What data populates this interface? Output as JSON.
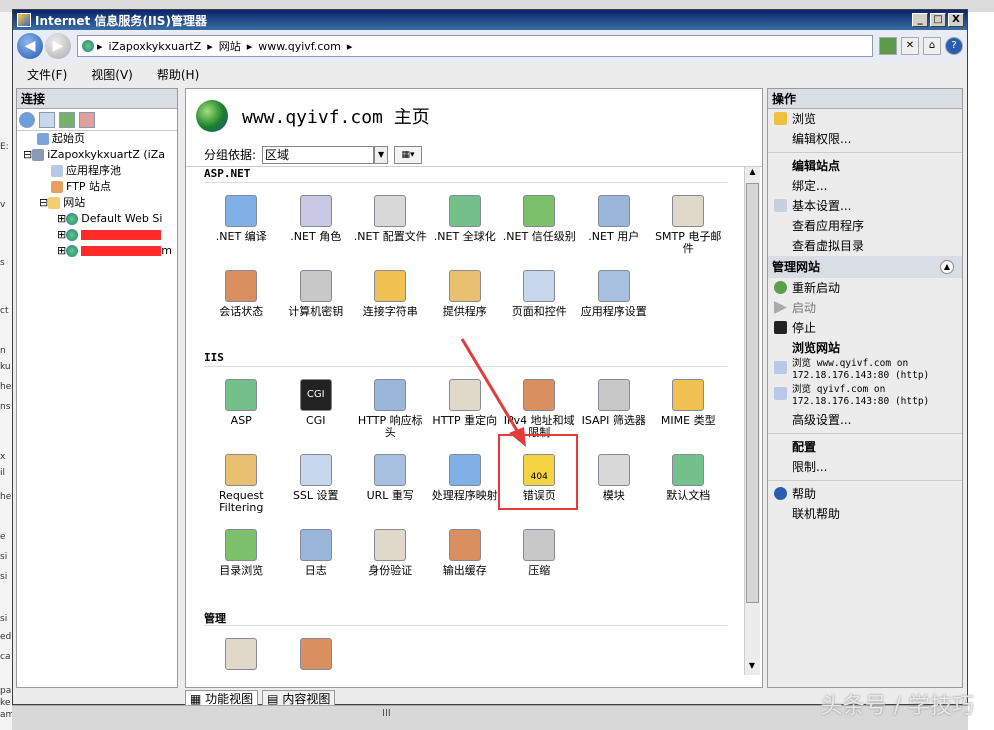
{
  "window": {
    "title": "Internet 信息服务(IIS)管理器",
    "controls": [
      "_",
      "□",
      "X"
    ]
  },
  "left_edge_chars": [
    "E:",
    "v",
    "s",
    "ct",
    "n",
    "ku",
    "he",
    "ns",
    "x",
    "il",
    "he",
    "e",
    "si",
    "si",
    "si",
    "ed",
    "ca",
    "pa",
    "ke",
    "am"
  ],
  "address": {
    "back": "◀",
    "forward": "▶",
    "crumbs": [
      "iZapoxkykxuartZ",
      "网站",
      "www.qyivf.com"
    ]
  },
  "menu": [
    "文件(F)",
    "视图(V)",
    "帮助(H)"
  ],
  "left_pane": {
    "header": "连接",
    "tree": [
      {
        "label": "起始页",
        "depth": 1
      },
      {
        "label": "iZapoxkykxuartZ (iZa",
        "depth": 0
      },
      {
        "label": "应用程序池",
        "depth": 2
      },
      {
        "label": "FTP 站点",
        "depth": 2
      },
      {
        "label": "网站",
        "depth": 2
      },
      {
        "label": "Default Web Si",
        "depth": 3
      },
      {
        "label": "",
        "depth": 3,
        "redacted": true
      },
      {
        "label": "m",
        "depth": 3,
        "redacted": true
      }
    ]
  },
  "center": {
    "title": "www.qyivf.com 主页",
    "group_by_label": "分组依据:",
    "group_by_value": "区域",
    "sections": [
      {
        "name": "ASP.NET",
        "items": [
          ".NET 编译",
          ".NET 角色",
          ".NET 配置文件",
          ".NET 全球化",
          ".NET 信任级别",
          ".NET 用户",
          "SMTP 电子邮件",
          "会话状态",
          "计算机密钥",
          "连接字符串",
          "提供程序",
          "页面和控件",
          "应用程序设置"
        ]
      },
      {
        "name": "IIS",
        "items": [
          "ASP",
          "CGI",
          "HTTP 响应标头",
          "HTTP 重定向",
          "IPv4 地址和域限制",
          "ISAPI 筛选器",
          "MIME 类型",
          "Request Filtering",
          "SSL 设置",
          "URL 重写",
          "处理程序映射",
          "错误页",
          "模块",
          "默认文档",
          "目录浏览",
          "日志",
          "身份验证",
          "输出缓存",
          "压缩"
        ]
      },
      {
        "name": "管理",
        "items": [
          "",
          ""
        ]
      }
    ],
    "highlighted_item": "错误页",
    "icon_text": {
      "cgi": "CGI",
      "error": "404"
    }
  },
  "bottom_tabs": [
    "功能视图",
    "内容视图"
  ],
  "right_pane": {
    "header": "操作",
    "actions_top": [
      "浏览",
      "编辑权限..."
    ],
    "edit_site_header": "编辑站点",
    "edit_site": [
      "绑定...",
      "基本设置...",
      "查看应用程序",
      "查看虚拟目录"
    ],
    "manage_header": "管理网站",
    "manage": [
      "重新启动",
      "启动",
      "停止"
    ],
    "browse_header": "浏览网站",
    "browse": [
      "浏览 www.qyivf.com on 172.18.176.143:80 (http)",
      "浏览 qyivf.com on 172.18.176.143:80 (http)"
    ],
    "advanced": "高级设置...",
    "config_header": "配置",
    "config": [
      "限制..."
    ],
    "help": [
      "帮助",
      "联机帮助"
    ]
  },
  "statusbar": {
    "grip": "III"
  },
  "watermark": "头条号 / 学技巧",
  "colors": {
    "titlebar": "#0a246a",
    "highlight": "#e53b3b",
    "redact": "#ff2a2a"
  }
}
